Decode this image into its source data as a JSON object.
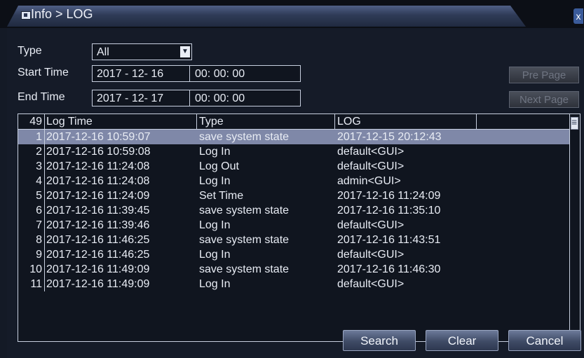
{
  "window": {
    "breadcrumb": "Info > LOG",
    "close_label": "x"
  },
  "filters": {
    "type_label": "Type",
    "type_value": "All",
    "start_label": "Start Time",
    "start_date": "2017 - 12- 16",
    "start_time": "00: 00: 00",
    "end_label": "End Time",
    "end_date": "2017 - 12- 17",
    "end_time": "00: 00: 00"
  },
  "paging": {
    "prev_label": "Pre Page",
    "next_label": "Next Page"
  },
  "table": {
    "count": "49",
    "headers": [
      "Log Time",
      "Type",
      "LOG"
    ],
    "selected_index": 0,
    "rows": [
      {
        "n": "1",
        "time": "2017-12-16 10:59:07",
        "type": "save system state",
        "log": "2017-12-15 20:12:43"
      },
      {
        "n": "2",
        "time": "2017-12-16 10:59:08",
        "type": "Log In",
        "log": "default<GUI>"
      },
      {
        "n": "3",
        "time": "2017-12-16 11:24:08",
        "type": "Log Out",
        "log": "default<GUI>"
      },
      {
        "n": "4",
        "time": "2017-12-16 11:24:08",
        "type": "Log In",
        "log": "admin<GUI>"
      },
      {
        "n": "5",
        "time": "2017-12-16 11:24:09",
        "type": "Set Time",
        "log": "2017-12-16 11:24:09"
      },
      {
        "n": "6",
        "time": "2017-12-16 11:39:45",
        "type": "save system state",
        "log": "2017-12-16 11:35:10"
      },
      {
        "n": "7",
        "time": "2017-12-16 11:39:46",
        "type": "Log In",
        "log": "default<GUI>"
      },
      {
        "n": "8",
        "time": "2017-12-16 11:46:25",
        "type": "save system state",
        "log": "2017-12-16 11:43:51"
      },
      {
        "n": "9",
        "time": "2017-12-16 11:46:25",
        "type": "Log In",
        "log": "default<GUI>"
      },
      {
        "n": "10",
        "time": "2017-12-16 11:49:09",
        "type": "save system state",
        "log": "2017-12-16 11:46:30"
      },
      {
        "n": "11",
        "time": "2017-12-16 11:49:09",
        "type": "Log In",
        "log": "default<GUI>"
      }
    ]
  },
  "actions": {
    "search_label": "Search",
    "clear_label": "Clear",
    "cancel_label": "Cancel"
  }
}
